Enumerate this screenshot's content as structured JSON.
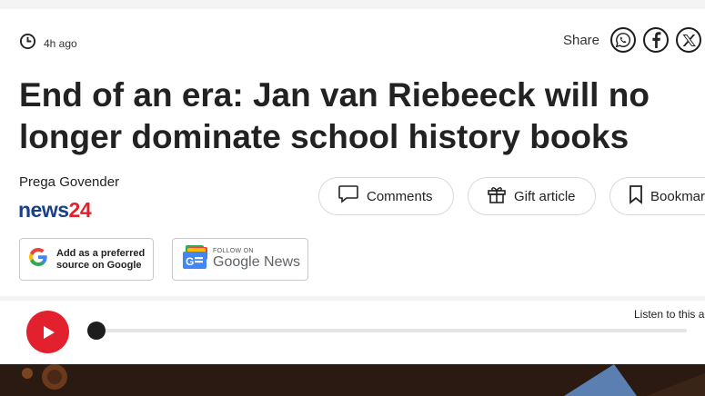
{
  "meta": {
    "time": "4h ago"
  },
  "share": {
    "label": "Share",
    "icons": [
      "whatsapp-icon",
      "facebook-icon",
      "x-icon"
    ]
  },
  "headline": "End of an era: Jan van Riebeeck will no longer dominate school history books",
  "author": "Prega Govender",
  "brand": {
    "part1": "news",
    "part2": "24"
  },
  "actions": {
    "comments": "Comments",
    "gift": "Gift article",
    "bookmark": "Bookmar"
  },
  "google_card": {
    "line1": "Add as a preferred",
    "line2": "source on Google"
  },
  "news_card": {
    "follow": "FOLLOW ON",
    "brand_google": "Google",
    "brand_news": "News"
  },
  "player": {
    "listen": "Listen to this a",
    "progress": 0
  },
  "colors": {
    "accent_red": "#e3212e",
    "brand_blue": "#1b3f8b"
  }
}
